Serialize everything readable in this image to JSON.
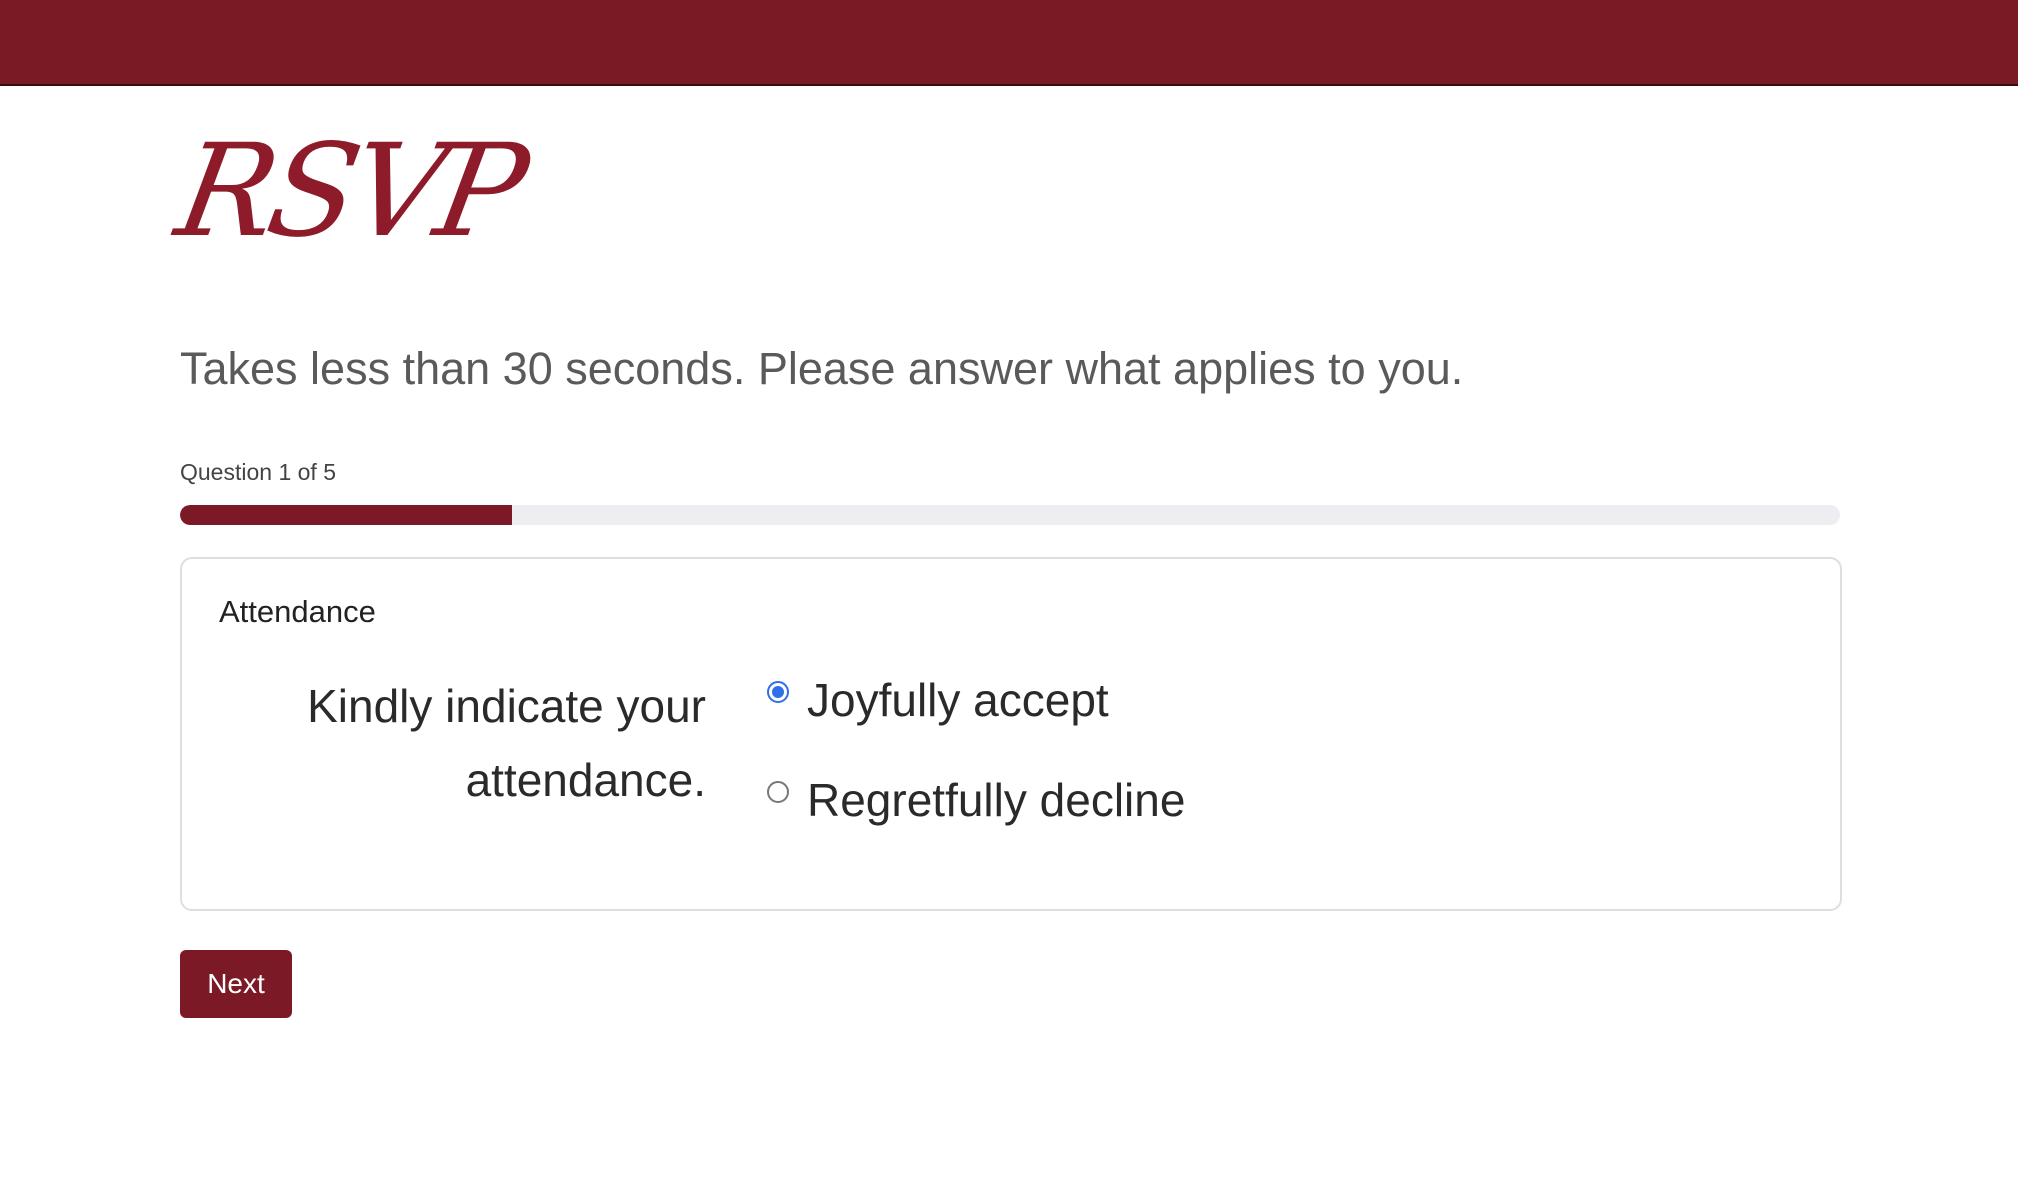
{
  "header": {
    "bar_color": "#791a24"
  },
  "logo": {
    "text": "RSVP"
  },
  "subtitle": "Takes less than 30 seconds. Please answer what applies to you.",
  "progress": {
    "label": "Question 1 of 5",
    "current": 1,
    "total": 5,
    "fraction": 0.2
  },
  "card": {
    "title": "Attendance",
    "question": "Kindly indicate your attendance.",
    "options": [
      {
        "label": "Joyfully accept",
        "selected": true
      },
      {
        "label": "Regretfully decline",
        "selected": false
      }
    ]
  },
  "actions": {
    "next_label": "Next"
  },
  "colors": {
    "accent": "#7b1a26",
    "radio_selected": "#2f6fe8"
  }
}
